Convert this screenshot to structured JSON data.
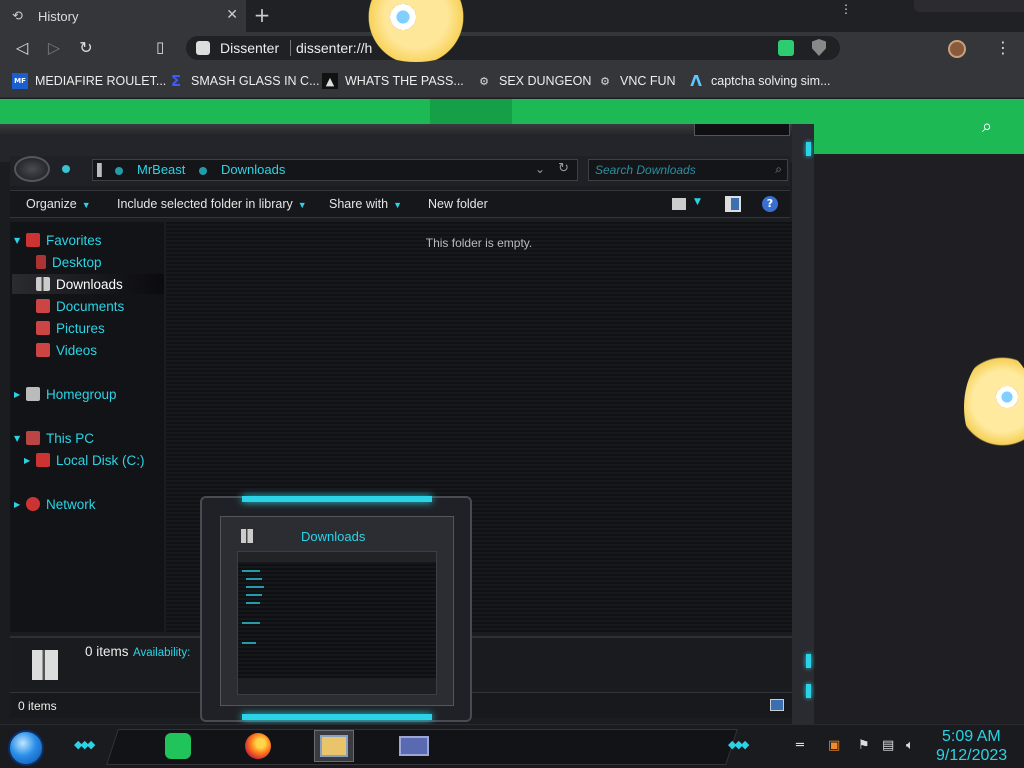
{
  "browser": {
    "tab_title": "History",
    "new_tab_label": "+",
    "close_label": "✕",
    "site_name": "Dissenter",
    "url": "dissenter://h",
    "bookmarks": [
      {
        "label": "MEDIAFIRE ROULET...",
        "icon": "mediafire-icon"
      },
      {
        "label": "SMASH GLASS IN C...",
        "icon": "glass-icon"
      },
      {
        "label": "WHATS THE PASS...",
        "icon": "lock-icon"
      },
      {
        "label": "SEX DUNGEON",
        "icon": "robot-icon"
      },
      {
        "label": "VNC FUN",
        "icon": "robot-icon"
      },
      {
        "label": "captcha solving sim...",
        "icon": "a-logo-icon"
      }
    ]
  },
  "explorer": {
    "breadcrumb": [
      "MrBeast",
      "Downloads"
    ],
    "search_placeholder": "Search Downloads",
    "commands": {
      "organize": "Organize",
      "include": "Include selected folder in library",
      "share": "Share with",
      "new_folder": "New folder"
    },
    "nav": {
      "favorites": "Favorites",
      "desktop": "Desktop",
      "downloads": "Downloads",
      "documents": "Documents",
      "pictures": "Pictures",
      "videos": "Videos",
      "homegroup": "Homegroup",
      "this_pc": "This PC",
      "local_disk": "Local Disk (C:)",
      "network": "Network"
    },
    "empty_message": "This folder is empty.",
    "details_count": "0 items",
    "details_availability": "Availability:",
    "status_count": "0 items"
  },
  "preview": {
    "title": "Downloads"
  },
  "taskbar": {
    "time": "5:09 AM",
    "date": "9/12/2023"
  },
  "colors": {
    "accent": "#2ad4e6",
    "page_green": "#1db954"
  }
}
